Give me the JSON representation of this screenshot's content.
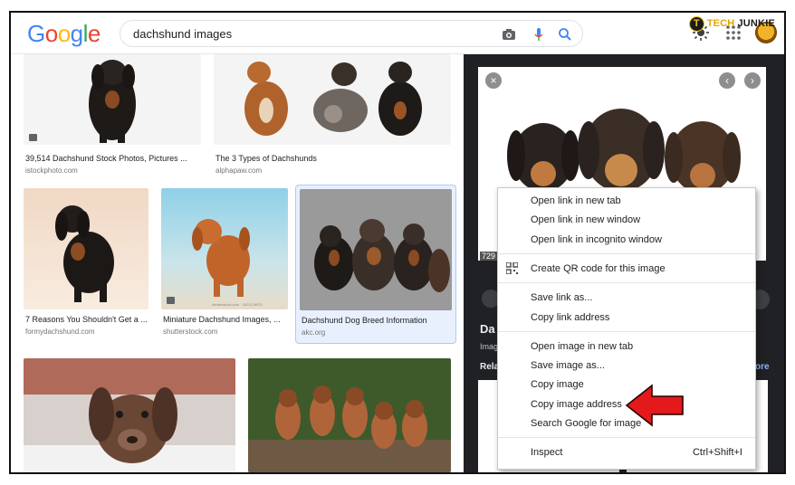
{
  "watermark": {
    "part1": "TECH",
    "part2": "JUNKIE",
    "logo_letter": "T"
  },
  "logo": {
    "letters": [
      "G",
      "o",
      "o",
      "g",
      "l",
      "e"
    ]
  },
  "search": {
    "query": "dachshund images"
  },
  "results": [
    {
      "title": "39,514 Dachshund Stock Photos, Pictures ...",
      "site": "istockphoto.com"
    },
    {
      "title": "The 3 Types of Dachshunds",
      "site": "alphapaw.com"
    },
    {
      "title": "7 Reasons You Shouldn't Get a ...",
      "site": "formydachshund.com"
    },
    {
      "title": "Miniature Dachshund Images, ...",
      "site": "shutterstock.com",
      "thumb_watermark": "shutterstock.com · 1621129570"
    },
    {
      "title": "Dachshund Dog Breed Information",
      "site": "akc.org"
    }
  ],
  "panel": {
    "image_size": "729",
    "title_fragment": "Da",
    "sub_fragment": "Imag",
    "related_fragment": "Rela",
    "more_fragment": "ore"
  },
  "context_menu": {
    "items": [
      "Open link in new tab",
      "Open link in new window",
      "Open link in incognito window",
      "Create QR code for this image",
      "Save link as...",
      "Copy link address",
      "Open image in new tab",
      "Save image as...",
      "Copy image",
      "Copy image address",
      "Search Google for image",
      "Inspect"
    ],
    "inspect_shortcut": "Ctrl+Shift+I"
  },
  "colors": {
    "accent": "#1a73e8",
    "arrow": "#e3191c",
    "panel_bg": "#202124"
  },
  "icons": [
    "camera-icon",
    "mic-icon",
    "search-icon",
    "brightness-icon",
    "apps-icon",
    "qr-code-icon",
    "close-icon",
    "prev-icon",
    "next-icon"
  ]
}
